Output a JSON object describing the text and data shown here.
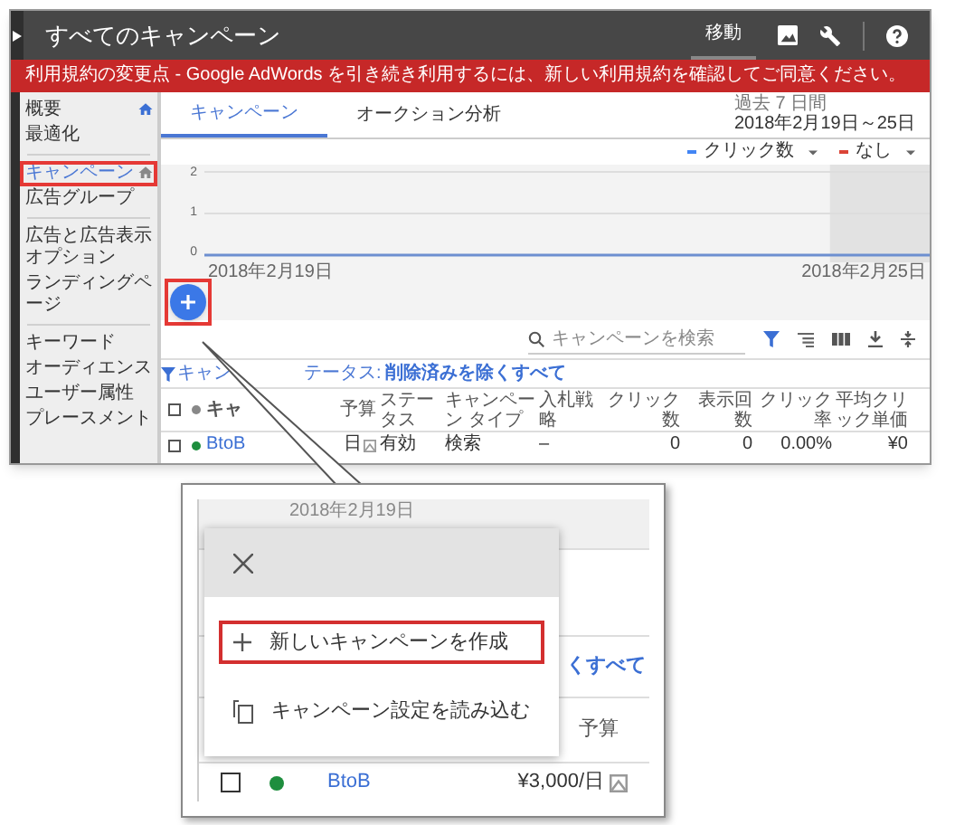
{
  "header": {
    "title": "すべてのキャンペーン",
    "move_label": "移動"
  },
  "banner": "利用規約の変更点 - Google AdWords を引き続き利用するには、新しい利用規約を確認してご同意ください。",
  "sidebar": {
    "items": [
      {
        "label": "概要",
        "selected": false,
        "home_icon": true,
        "divider_after": false
      },
      {
        "label": "最適化",
        "selected": false,
        "home_icon": false,
        "divider_after": true
      },
      {
        "label": "キャンペーン",
        "selected": true,
        "home_icon": true,
        "divider_after": false
      },
      {
        "label": "広告グループ",
        "selected": false,
        "home_icon": false,
        "divider_after": true
      },
      {
        "label": "広告と広告表示オプション",
        "selected": false,
        "home_icon": false,
        "divider_after": false
      },
      {
        "label": "ランディングページ",
        "selected": false,
        "home_icon": false,
        "divider_after": true
      },
      {
        "label": "キーワード",
        "selected": false,
        "home_icon": false,
        "divider_after": false
      },
      {
        "label": "オーディエンス",
        "selected": false,
        "home_icon": false,
        "divider_after": false
      },
      {
        "label": "ユーザー属性",
        "selected": false,
        "home_icon": false,
        "divider_after": false
      },
      {
        "label": "プレースメント",
        "selected": false,
        "home_icon": false,
        "divider_after": false
      }
    ]
  },
  "tabs": [
    {
      "label": "キャンペーン",
      "selected": true
    },
    {
      "label": "オークション分析",
      "selected": false
    }
  ],
  "date_range": {
    "label": "過去 7 日間",
    "value": "2018年2月19日～25日"
  },
  "legend": [
    {
      "label": "クリック数",
      "color": "#4285f4"
    },
    {
      "label": "なし",
      "color": "#db4437"
    }
  ],
  "chart": {
    "y_labels": [
      "2",
      "1",
      "0"
    ],
    "x_labels": [
      "2018年2月19日",
      "2018年2月25日"
    ]
  },
  "search": {
    "placeholder": "キャンペーンを検索"
  },
  "filter": {
    "head": "キャン",
    "tail": "テータス:",
    "value": "削除済みを除くすべて"
  },
  "table": {
    "header_checked": false,
    "columns": [
      "キャ",
      "予算",
      "ステータス",
      "キャンペーン タイプ",
      "入札戦略",
      "クリック数",
      "表示回数",
      "クリック率",
      "平均クリック単価"
    ],
    "rows": [
      {
        "checked": false,
        "color": "#1e8e3e",
        "cells": [
          "BtoB",
          "日",
          "有効",
          "検索",
          "–",
          "0",
          "0",
          "0.00%",
          "¥0"
        ]
      }
    ]
  },
  "callout": {
    "date": "2018年2月19日",
    "menu": [
      {
        "kind": "create",
        "label": "新しいキャンペーンを作成",
        "highlighted": true
      },
      {
        "kind": "load",
        "label": "キャンペーン設定を読み込む",
        "highlighted": false
      }
    ],
    "filter_tail": "くすべて",
    "budget_header": "予算",
    "row": {
      "checked": false,
      "color": "#1e8e3e",
      "name": "BtoB",
      "budget": "¥3,000/日"
    }
  }
}
